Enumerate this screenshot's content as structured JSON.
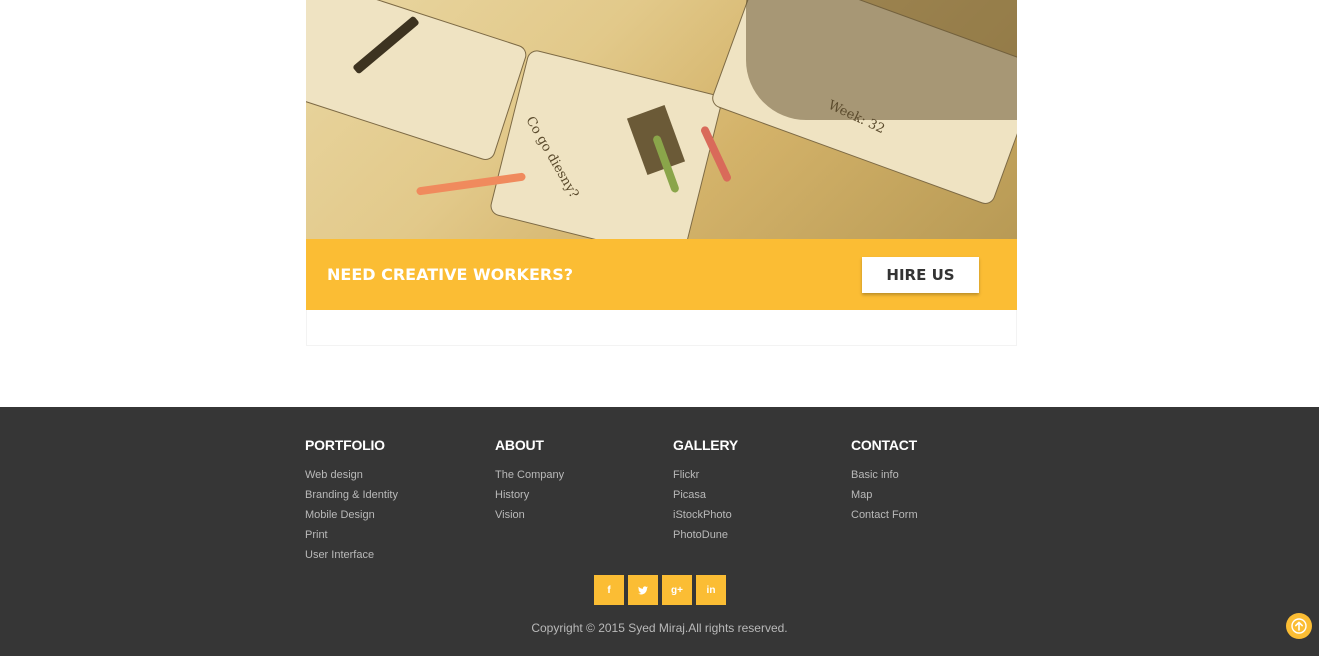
{
  "cta": {
    "title": "NEED CREATIVE WORKERS?",
    "button": "HIRE US"
  },
  "hero": {
    "handwriting_1": "Co go diesny?",
    "handwriting_2": "Week: 32"
  },
  "footer": {
    "columns": [
      {
        "heading": "PORTFOLIO",
        "items": [
          "Web design",
          "Branding & Identity",
          "Mobile Design",
          "Print",
          "User Interface"
        ]
      },
      {
        "heading": "ABOUT",
        "items": [
          "The Company",
          "History",
          "Vision"
        ]
      },
      {
        "heading": "GALLERY",
        "items": [
          "Flickr",
          "Picasa",
          "iStockPhoto",
          "PhotoDune"
        ]
      },
      {
        "heading": "CONTACT",
        "items": [
          "Basic info",
          "Map",
          "Contact Form"
        ]
      }
    ],
    "social": [
      {
        "icon": "facebook-icon",
        "glyph": "f"
      },
      {
        "icon": "twitter-icon",
        "glyph": "t"
      },
      {
        "icon": "google-plus-icon",
        "glyph": "g+"
      },
      {
        "icon": "linkedin-icon",
        "glyph": "in"
      }
    ],
    "copyright": "Copyright © 2015 Syed Miraj.All rights reserved."
  },
  "colors": {
    "accent": "#fbbd34",
    "footer_bg": "#363636",
    "footer_text": "#b9b9b9"
  },
  "scroll_top_icon": "arrow-up-icon"
}
